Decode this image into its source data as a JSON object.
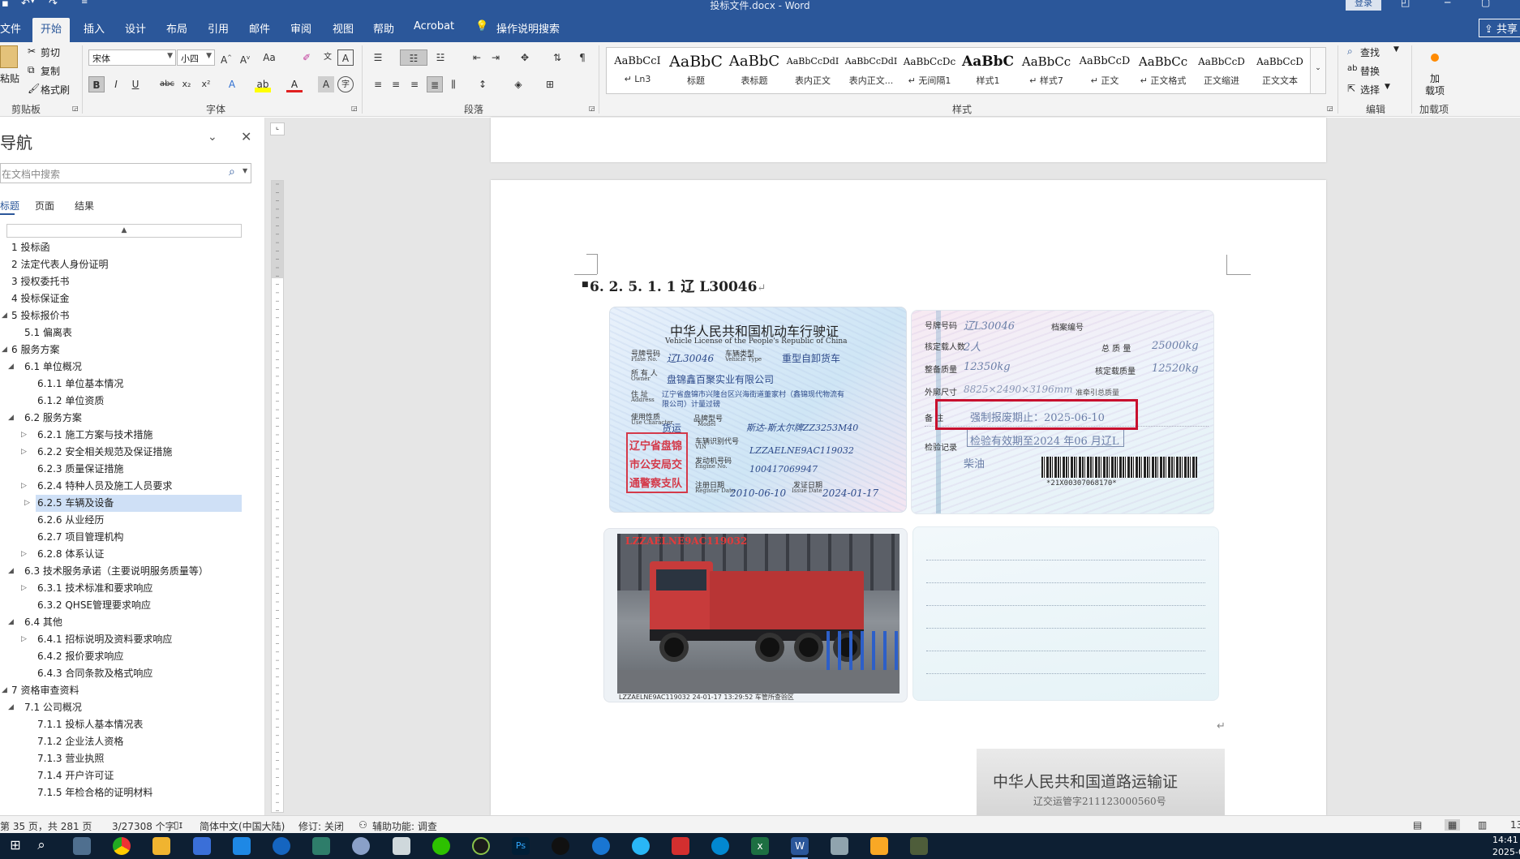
{
  "window": {
    "title": "投标文件.docx  -  Word",
    "login": "登录"
  },
  "tabs": [
    {
      "label": "文件"
    },
    {
      "label": "开始"
    },
    {
      "label": "插入"
    },
    {
      "label": "设计"
    },
    {
      "label": "布局"
    },
    {
      "label": "引用"
    },
    {
      "label": "邮件"
    },
    {
      "label": "审阅"
    },
    {
      "label": "视图"
    },
    {
      "label": "帮助"
    },
    {
      "label": "Acrobat"
    },
    {
      "label": "操作说明搜索"
    }
  ],
  "share_label": "共享",
  "ribbon": {
    "clipboard": {
      "paste": "粘贴",
      "cut": "剪切",
      "copy": "复制",
      "format_painter": "格式刷",
      "label": "剪贴板"
    },
    "font": {
      "family": "宋体",
      "size": "小四",
      "label": "字体"
    },
    "paragraph": {
      "label": "段落"
    },
    "styles": {
      "label": "样式",
      "items": [
        {
          "preview": "AaBbCcI",
          "name": "↵ Ln3"
        },
        {
          "preview": "AaBbC",
          "name": "标题"
        },
        {
          "preview": "AaBbC",
          "name": "表标题"
        },
        {
          "preview": "AaBbCcDdI",
          "name": "表内正文"
        },
        {
          "preview": "AaBbCcDdI",
          "name": "表内正文..."
        },
        {
          "preview": "AaBbCcDc",
          "name": "↵ 无间隔1"
        },
        {
          "preview": "AaBbC",
          "name": "样式1"
        },
        {
          "preview": "AaBbCc",
          "name": "↵ 样式7"
        },
        {
          "preview": "AaBbCcD",
          "name": "↵ 正文"
        },
        {
          "preview": "AaBbCc",
          "name": "↵ 正文格式"
        },
        {
          "preview": "AaBbCcD",
          "name": "正文缩进"
        },
        {
          "preview": "AaBbCcD",
          "name": "正文文本"
        }
      ]
    },
    "editing": {
      "find": "查找",
      "replace": "替换",
      "select": "选择",
      "label": "编辑"
    },
    "addins": {
      "button": "加\n载项",
      "label": "加载项"
    }
  },
  "nav": {
    "title": "导航",
    "search_placeholder": "在文档中搜索",
    "tabs": [
      "标题",
      "页面",
      "结果"
    ],
    "items": [
      {
        "label": "1 投标函",
        "level": 0,
        "exp": ""
      },
      {
        "label": "2 法定代表人身份证明",
        "level": 0,
        "exp": ""
      },
      {
        "label": "3 授权委托书",
        "level": 0,
        "exp": ""
      },
      {
        "label": "4 投标保证金",
        "level": 0,
        "exp": ""
      },
      {
        "label": "5 投标报价书",
        "level": 0,
        "exp": "◢"
      },
      {
        "label": "5.1 偏离表",
        "level": 1,
        "exp": ""
      },
      {
        "label": "6 服务方案",
        "level": 0,
        "exp": "◢"
      },
      {
        "label": "6.1 单位概况",
        "level": 1,
        "exp": "◢"
      },
      {
        "label": "6.1.1 单位基本情况",
        "level": 2,
        "exp": ""
      },
      {
        "label": "6.1.2 单位资质",
        "level": 2,
        "exp": ""
      },
      {
        "label": "6.2 服务方案",
        "level": 1,
        "exp": "◢"
      },
      {
        "label": "6.2.1 施工方案与技术措施",
        "level": 2,
        "exp": "▷"
      },
      {
        "label": "6.2.2 安全相关规范及保证措施",
        "level": 2,
        "exp": "▷"
      },
      {
        "label": "6.2.3 质量保证措施",
        "level": 2,
        "exp": ""
      },
      {
        "label": "6.2.4 特种人员及施工人员要求",
        "level": 2,
        "exp": "▷"
      },
      {
        "label": "6.2.5 车辆及设备",
        "level": 2,
        "exp": "▷",
        "selected": true
      },
      {
        "label": "6.2.6 从业经历",
        "level": 2,
        "exp": ""
      },
      {
        "label": "6.2.7 项目管理机构",
        "level": 2,
        "exp": ""
      },
      {
        "label": "6.2.8 体系认证",
        "level": 2,
        "exp": "▷"
      },
      {
        "label": "6.3 技术服务承诺（主要说明服务质量等）",
        "level": 1,
        "exp": "◢"
      },
      {
        "label": "6.3.1 技术标准和要求响应",
        "level": 2,
        "exp": "▷"
      },
      {
        "label": "6.3.2 QHSE管理要求响应",
        "level": 2,
        "exp": ""
      },
      {
        "label": "6.4 其他",
        "level": 1,
        "exp": "◢"
      },
      {
        "label": "6.4.1 招标说明及资料要求响应",
        "level": 2,
        "exp": "▷"
      },
      {
        "label": "6.4.2 报价要求响应",
        "level": 2,
        "exp": ""
      },
      {
        "label": "6.4.3 合同条款及格式响应",
        "level": 2,
        "exp": ""
      },
      {
        "label": "7 资格审查资料",
        "level": 0,
        "exp": "◢"
      },
      {
        "label": "7.1 公司概况",
        "level": 1,
        "exp": "◢"
      },
      {
        "label": "7.1.1 投标人基本情况表",
        "level": 2,
        "exp": ""
      },
      {
        "label": "7.1.2 企业法人资格",
        "level": 2,
        "exp": ""
      },
      {
        "label": "7.1.3 营业执照",
        "level": 2,
        "exp": ""
      },
      {
        "label": "7.1.4 开户许可证",
        "level": 2,
        "exp": ""
      },
      {
        "label": "7.1.5 年检合格的证明材料",
        "level": 2,
        "exp": ""
      }
    ]
  },
  "document": {
    "heading": "6. 2. 5. 1. 1   辽 L30046",
    "para_mark": "↵",
    "license_front": {
      "title_cn": "中华人民共和国机动车行驶证",
      "title_en": "Vehicle License of the People's Republic of China",
      "plate_label": "号牌号码",
      "plate_label_en": "Plate No.",
      "plate": "辽L30046",
      "type_label": "车辆类型",
      "type_label_en": "Vehicle Type",
      "type": "重型自卸货车",
      "owner_label": "所 有 人",
      "owner_label_en": "Owner",
      "owner": "盘锦鑫百聚实业有限公司",
      "address_label": "住    址",
      "address_label_en": "Address",
      "address": "辽宁省盘锦市兴隆台区兴海街道董家村（鑫锦现代物流有",
      "address2": "限公司）计量过磅",
      "use_label": "使用性质",
      "use_label_en": "Use Character",
      "use": "货运",
      "model_label": "品牌型号",
      "model_label_en": "Model",
      "model": "斯达-斯太尔牌ZZ3253M40",
      "vin_label": "车辆识别代号",
      "vin_label_en": "VIN",
      "vin": "LZZAELNE9AC119032",
      "engine_label": "发动机号码",
      "engine_label_en": "Engine No.",
      "engine": "100417069947",
      "reg_label": "注册日期",
      "reg_label_en": "Register Date",
      "reg": "2010-06-10",
      "issue_label": "发证日期",
      "issue_label_en": "Issue Date",
      "issue": "2024-01-17",
      "seal_lines": [
        "辽宁省盘锦",
        "市公安局交",
        "通警察支队"
      ]
    },
    "license_back": {
      "plate_label": "号牌号码",
      "plate": "辽L30046",
      "file_label": "档案编号",
      "passengers_label": "核定载人数",
      "passengers": "2人",
      "gross_label": "总 质 量",
      "gross": "25000kg",
      "curb_label": "整备质量",
      "curb": "12350kg",
      "load_label": "核定载质量",
      "load": "12520kg",
      "dims_label": "外廓尺寸",
      "dims": "8825×2490×3196mm",
      "tow_label": "准牵引总质量",
      "remark_label": "备  注",
      "remark": "强制报废期止：2025-06-10",
      "inspect_label": "检验记录",
      "inspect": "检验有效期至2024 年06 月辽L",
      "fuel": "柴油",
      "barcode_text": "*21X00307068170*"
    },
    "photo": {
      "vin_overlay": "LZZAELNE9AC119032",
      "footer": "LZZAELNE9AC119032 24-01-17 13:29:52 车管所查验区"
    },
    "transport_title": "中华人民共和国道路运输证",
    "transport_sub": "辽交运管字211123000560号"
  },
  "status": {
    "page": "第 35 页，共 281 页",
    "words": "3/27308 个字",
    "lang": "简体中文(中国大陆)",
    "track": "修订: 关闭",
    "access": "辅助功能: 调查",
    "zoom": "13"
  },
  "clock": {
    "time": "14:41",
    "date": "2025-0"
  }
}
